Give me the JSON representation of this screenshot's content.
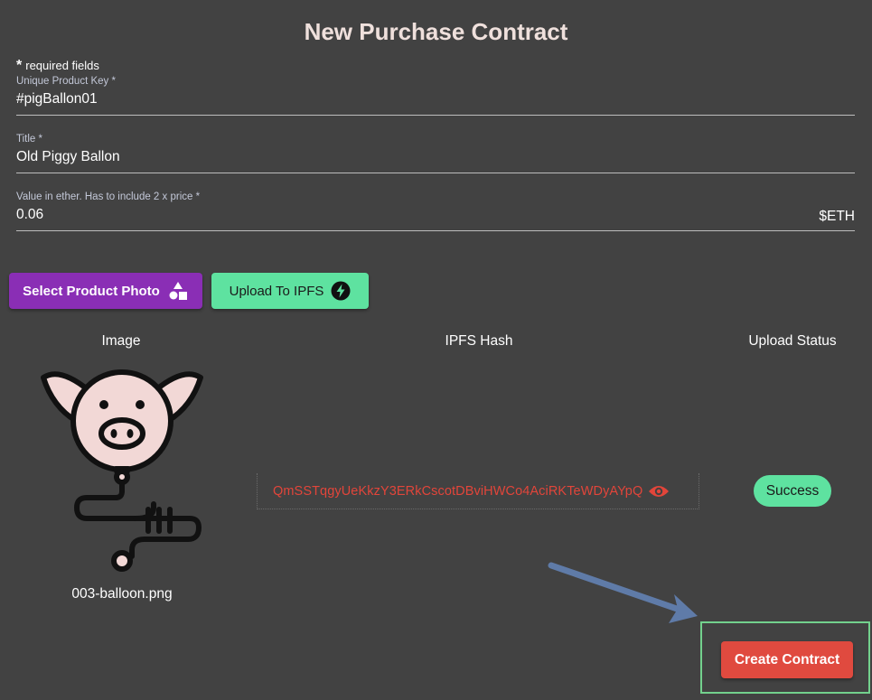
{
  "page": {
    "title": "New Purchase Contract"
  },
  "form": {
    "required_star": "*",
    "required_note": "required fields",
    "product_key": {
      "label": "Unique Product Key *",
      "value": "#pigBallon01"
    },
    "title": {
      "label": "Title *",
      "value": "Old Piggy Ballon"
    },
    "value": {
      "label": "Value in ether. Has to include 2 x price *",
      "value": "0.06",
      "unit": "$ETH"
    }
  },
  "actions": {
    "select_photo_label": "Select Product Photo",
    "upload_ipfs_label": "Upload To IPFS",
    "create_contract_label": "Create Contract"
  },
  "table": {
    "headers": {
      "image": "Image",
      "hash": "IPFS Hash",
      "status": "Upload Status"
    },
    "row": {
      "filename": "003-balloon.png",
      "hash": "QmSSTqgyUeKkzY3ERkCscotDBviHWCo4AciRKTeWDyAYpQ",
      "status": "Success"
    }
  },
  "icons": {
    "select_photo": "shapes-icon",
    "upload_ipfs": "lightning-icon",
    "hash_view": "eye-icon"
  },
  "colors": {
    "background": "#424242",
    "primary_purple": "#8a2eb5",
    "accent_green": "#5ee2a0",
    "danger_red": "#e04a3f",
    "hash_red": "#e2453a",
    "highlight_frame": "#73d18d",
    "annotation_arrow": "#5f7ba8"
  }
}
